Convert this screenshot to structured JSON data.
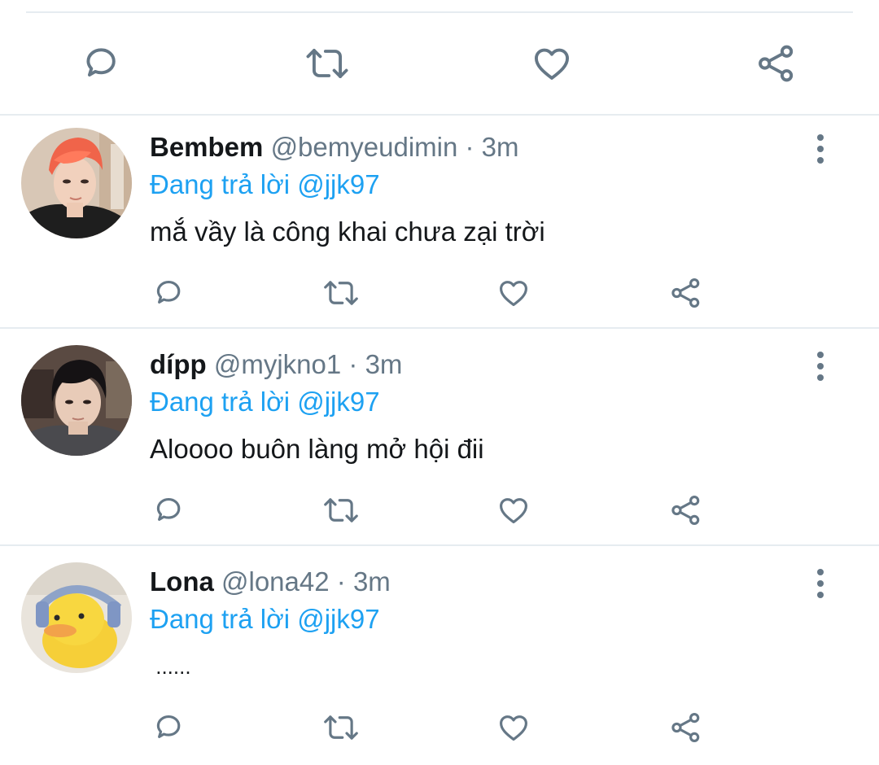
{
  "theme": {
    "icon_color": "#657786",
    "link_color": "#1da1f2",
    "text_color": "#14171a",
    "divider_color": "#e6ecf0"
  },
  "top_action_bar": {
    "icons": [
      "reply-icon",
      "retweet-icon",
      "like-icon",
      "share-icon"
    ]
  },
  "tweets": [
    {
      "name": "Bembem",
      "handle": "@bemyeudimin",
      "separator": "·",
      "time": "3m",
      "reply_prefix": "Đang trả lời",
      "reply_to": "@jjk97",
      "text": "mắ vầy là công khai chưa zại trời",
      "avatar": "avatar-orange-hair"
    },
    {
      "name": "dípp",
      "handle": "@myjkno1",
      "separator": "·",
      "time": "3m",
      "reply_prefix": "Đang trả lời",
      "reply_to": "@jjk97",
      "text": "Aloooo buôn làng mở hội đii",
      "avatar": "avatar-dark-hair"
    },
    {
      "name": "Lona",
      "handle": "@lona42",
      "separator": "·",
      "time": "3m",
      "reply_prefix": "Đang trả lời",
      "reply_to": "@jjk97",
      "text": " ......",
      "avatar": "avatar-duck"
    }
  ]
}
